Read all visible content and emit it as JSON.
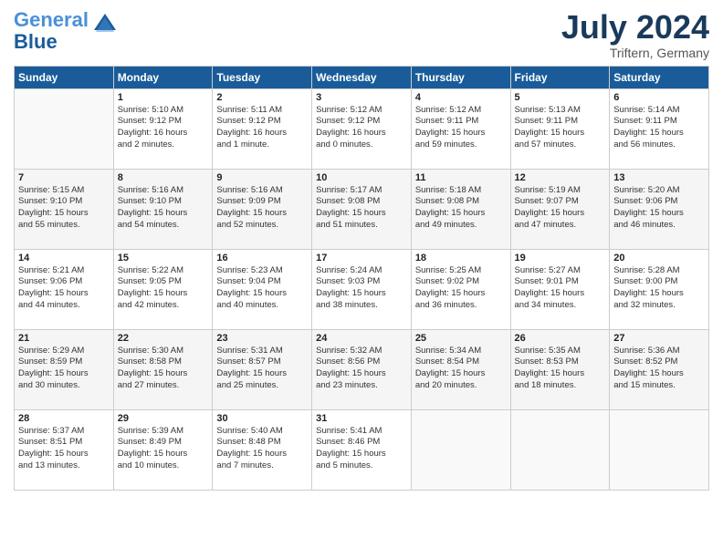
{
  "header": {
    "logo_general": "General",
    "logo_blue": "Blue",
    "month_year": "July 2024",
    "location": "Triftern, Germany"
  },
  "days_of_week": [
    "Sunday",
    "Monday",
    "Tuesday",
    "Wednesday",
    "Thursday",
    "Friday",
    "Saturday"
  ],
  "weeks": [
    [
      {
        "day": "",
        "info": ""
      },
      {
        "day": "1",
        "info": "Sunrise: 5:10 AM\nSunset: 9:12 PM\nDaylight: 16 hours\nand 2 minutes."
      },
      {
        "day": "2",
        "info": "Sunrise: 5:11 AM\nSunset: 9:12 PM\nDaylight: 16 hours\nand 1 minute."
      },
      {
        "day": "3",
        "info": "Sunrise: 5:12 AM\nSunset: 9:12 PM\nDaylight: 16 hours\nand 0 minutes."
      },
      {
        "day": "4",
        "info": "Sunrise: 5:12 AM\nSunset: 9:11 PM\nDaylight: 15 hours\nand 59 minutes."
      },
      {
        "day": "5",
        "info": "Sunrise: 5:13 AM\nSunset: 9:11 PM\nDaylight: 15 hours\nand 57 minutes."
      },
      {
        "day": "6",
        "info": "Sunrise: 5:14 AM\nSunset: 9:11 PM\nDaylight: 15 hours\nand 56 minutes."
      }
    ],
    [
      {
        "day": "7",
        "info": "Sunrise: 5:15 AM\nSunset: 9:10 PM\nDaylight: 15 hours\nand 55 minutes."
      },
      {
        "day": "8",
        "info": "Sunrise: 5:16 AM\nSunset: 9:10 PM\nDaylight: 15 hours\nand 54 minutes."
      },
      {
        "day": "9",
        "info": "Sunrise: 5:16 AM\nSunset: 9:09 PM\nDaylight: 15 hours\nand 52 minutes."
      },
      {
        "day": "10",
        "info": "Sunrise: 5:17 AM\nSunset: 9:08 PM\nDaylight: 15 hours\nand 51 minutes."
      },
      {
        "day": "11",
        "info": "Sunrise: 5:18 AM\nSunset: 9:08 PM\nDaylight: 15 hours\nand 49 minutes."
      },
      {
        "day": "12",
        "info": "Sunrise: 5:19 AM\nSunset: 9:07 PM\nDaylight: 15 hours\nand 47 minutes."
      },
      {
        "day": "13",
        "info": "Sunrise: 5:20 AM\nSunset: 9:06 PM\nDaylight: 15 hours\nand 46 minutes."
      }
    ],
    [
      {
        "day": "14",
        "info": "Sunrise: 5:21 AM\nSunset: 9:06 PM\nDaylight: 15 hours\nand 44 minutes."
      },
      {
        "day": "15",
        "info": "Sunrise: 5:22 AM\nSunset: 9:05 PM\nDaylight: 15 hours\nand 42 minutes."
      },
      {
        "day": "16",
        "info": "Sunrise: 5:23 AM\nSunset: 9:04 PM\nDaylight: 15 hours\nand 40 minutes."
      },
      {
        "day": "17",
        "info": "Sunrise: 5:24 AM\nSunset: 9:03 PM\nDaylight: 15 hours\nand 38 minutes."
      },
      {
        "day": "18",
        "info": "Sunrise: 5:25 AM\nSunset: 9:02 PM\nDaylight: 15 hours\nand 36 minutes."
      },
      {
        "day": "19",
        "info": "Sunrise: 5:27 AM\nSunset: 9:01 PM\nDaylight: 15 hours\nand 34 minutes."
      },
      {
        "day": "20",
        "info": "Sunrise: 5:28 AM\nSunset: 9:00 PM\nDaylight: 15 hours\nand 32 minutes."
      }
    ],
    [
      {
        "day": "21",
        "info": "Sunrise: 5:29 AM\nSunset: 8:59 PM\nDaylight: 15 hours\nand 30 minutes."
      },
      {
        "day": "22",
        "info": "Sunrise: 5:30 AM\nSunset: 8:58 PM\nDaylight: 15 hours\nand 27 minutes."
      },
      {
        "day": "23",
        "info": "Sunrise: 5:31 AM\nSunset: 8:57 PM\nDaylight: 15 hours\nand 25 minutes."
      },
      {
        "day": "24",
        "info": "Sunrise: 5:32 AM\nSunset: 8:56 PM\nDaylight: 15 hours\nand 23 minutes."
      },
      {
        "day": "25",
        "info": "Sunrise: 5:34 AM\nSunset: 8:54 PM\nDaylight: 15 hours\nand 20 minutes."
      },
      {
        "day": "26",
        "info": "Sunrise: 5:35 AM\nSunset: 8:53 PM\nDaylight: 15 hours\nand 18 minutes."
      },
      {
        "day": "27",
        "info": "Sunrise: 5:36 AM\nSunset: 8:52 PM\nDaylight: 15 hours\nand 15 minutes."
      }
    ],
    [
      {
        "day": "28",
        "info": "Sunrise: 5:37 AM\nSunset: 8:51 PM\nDaylight: 15 hours\nand 13 minutes."
      },
      {
        "day": "29",
        "info": "Sunrise: 5:39 AM\nSunset: 8:49 PM\nDaylight: 15 hours\nand 10 minutes."
      },
      {
        "day": "30",
        "info": "Sunrise: 5:40 AM\nSunset: 8:48 PM\nDaylight: 15 hours\nand 7 minutes."
      },
      {
        "day": "31",
        "info": "Sunrise: 5:41 AM\nSunset: 8:46 PM\nDaylight: 15 hours\nand 5 minutes."
      },
      {
        "day": "",
        "info": ""
      },
      {
        "day": "",
        "info": ""
      },
      {
        "day": "",
        "info": ""
      }
    ]
  ]
}
